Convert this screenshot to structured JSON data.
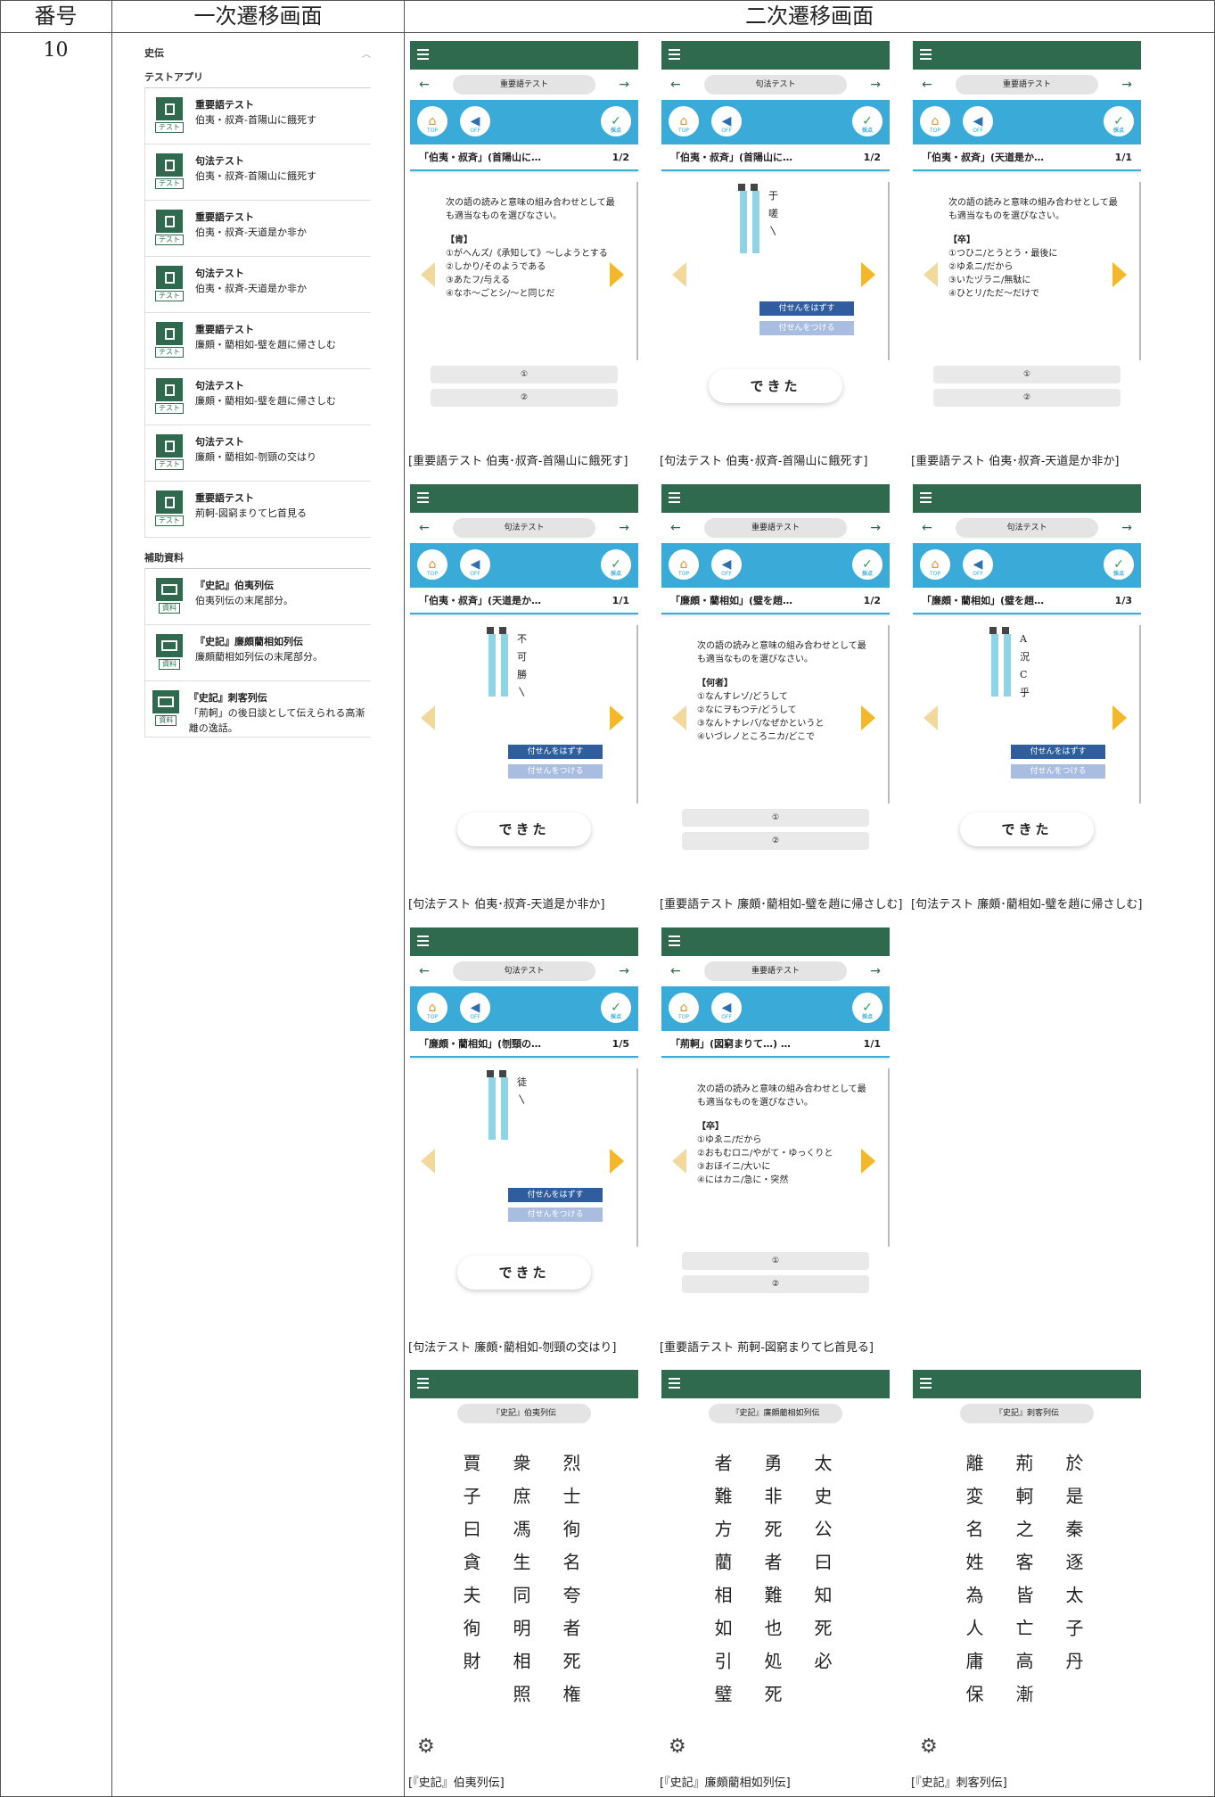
{
  "table": {
    "col_number": "番号",
    "col_primary": "一次遷移画面",
    "col_secondary": "二次遷移画面",
    "row_number": "10"
  },
  "primary": {
    "section": "史伝",
    "test_group": "テストアプリ",
    "material_group": "補助資料",
    "items": [
      {
        "title": "重要語テスト",
        "desc": "伯夷・叔斉-首陽山に餓死す",
        "tag": "テスト"
      },
      {
        "title": "句法テスト",
        "desc": "伯夷・叔斉-首陽山に餓死す",
        "tag": "テスト"
      },
      {
        "title": "重要語テスト",
        "desc": "伯夷・叔斉-天道是か非か",
        "tag": "テスト"
      },
      {
        "title": "句法テスト",
        "desc": "伯夷・叔斉-天道是か非か",
        "tag": "テスト"
      },
      {
        "title": "重要語テスト",
        "desc": "廉頗・藺相如-璧を趙に帰さしむ",
        "tag": "テスト"
      },
      {
        "title": "句法テスト",
        "desc": "廉頗・藺相如-璧を趙に帰さしむ",
        "tag": "テスト"
      },
      {
        "title": "句法テスト",
        "desc": "廉頗・藺相如-刎頸の交はり",
        "tag": "テスト"
      },
      {
        "title": "重要語テスト",
        "desc": "荊軻-図窮まりて匕首見る",
        "tag": "テスト"
      }
    ],
    "materials": [
      {
        "title": "『史記』伯夷列伝",
        "desc": "伯夷列伝の末尾部分。",
        "tag": "資料"
      },
      {
        "title": "『史記』廉頗藺相如列伝",
        "desc": "廉頗藺相如列伝の末尾部分。",
        "tag": "資料"
      },
      {
        "title": "『史記』刺客列伝",
        "desc": "「荊軻」の後日談として伝えられる高漸離の逸話。",
        "tag": "資料"
      }
    ]
  },
  "ui": {
    "top": "TOP",
    "off": "OFF",
    "score": "採点",
    "remove_sticky": "付せんをはずす",
    "add_sticky": "付せんをつける",
    "done": "できた",
    "opt1": "①",
    "opt2": "②",
    "prompt": "次の語の読みと意味の組み合わせとして最も適当なものを選びなさい。"
  },
  "screens": [
    {
      "type": "vocab",
      "pill": "重要語テスト",
      "q": "「伯夷・叔斉」(首陽山に…",
      "page": "1/2",
      "kw": "【肯】",
      "opts": "①がへんズ/《承知して》～しようとする\n②しかり/そのようである\n③あたフ/与える\n④なホ～ごとシ/～と同じだ",
      "caption": "[重要語テスト 伯夷･叔斉-首陽山に餓死す]"
    },
    {
      "type": "grammar",
      "pill": "句法テスト",
      "q": "「伯夷・叔斉」(首陽山に…",
      "page": "1/2",
      "kanbun": "于\n嗟\n〵",
      "caption": "[句法テスト 伯夷･叔斉-首陽山に餓死す]"
    },
    {
      "type": "vocab",
      "pill": "重要語テスト",
      "q": "「伯夷・叔斉」(天道是か…",
      "page": "1/1",
      "kw": "【卒】",
      "opts": "①つひニ/とうとう・最後に\n②ゆゑニ/だから\n③いたヅラニ/無駄に\n④ひとリ/ただ～だけで",
      "caption": "[重要語テスト 伯夷･叔斉-天道是か非か]"
    },
    {
      "type": "grammar",
      "pill": "句法テスト",
      "q": "「伯夷・叔斉」(天道是か…",
      "page": "1/1",
      "kanbun": "不\n可\n勝\n〵",
      "caption": "[句法テスト 伯夷･叔斉-天道是か非か]"
    },
    {
      "type": "vocab",
      "pill": "重要語テスト",
      "q": "「廉頗・藺相如」(璧を趙…",
      "page": "1/2",
      "kw": "【何者】",
      "opts": "①なんすレゾ/どうして\n②なにヲもつテ/どうして\n③なんトナレバ/なぜかというと\n④いづレノところニカ/どこで",
      "caption": "[重要語テスト 廉頗･藺相如-璧を趙に帰さしむ]"
    },
    {
      "type": "grammar",
      "pill": "句法テスト",
      "q": "「廉頗・藺相如」(璧を趙…",
      "page": "1/3",
      "kanbun": "A\n況\nC\n乎",
      "caption": "[句法テスト 廉頗･藺相如-璧を趙に帰さしむ]"
    },
    {
      "type": "grammar",
      "pill": "句法テスト",
      "q": "「廉頗・藺相如」(刎頸の…",
      "page": "1/5",
      "kanbun": "徒\n〵",
      "caption": "[句法テスト 廉頗･藺相如-刎頸の交はり]"
    },
    {
      "type": "vocab",
      "pill": "重要語テスト",
      "q": "「荊軻」(図窮まりて…) …",
      "page": "1/1",
      "kw": "【卒】",
      "opts": "①ゆゑニ/だから\n②おもむロニ/やがて・ゆっくりと\n③おほイニ/大いに\n④にはカニ/急に・突然",
      "caption": "[重要語テスト 荊軻-図窮まりて匕首見る]"
    }
  ],
  "readings": [
    {
      "pill": "『史記』伯夷列伝",
      "cols": [
        "烈士徇名夸者死権",
        "衆庶馮生同明相照",
        "賈子曰貪夫徇財"
      ],
      "caption": "[『史記』伯夷列伝]"
    },
    {
      "pill": "『史記』廉頗藺相如列伝",
      "cols": [
        "太史公曰知死必",
        "勇非死者難也処死",
        "者難方藺相如引璧"
      ],
      "caption": "[『史記』廉頗藺相如列伝]"
    },
    {
      "pill": "『史記』刺客列伝",
      "cols": [
        "於是秦逐太子丹",
        "荊軻之客皆亡高漸",
        "離変名姓為人庸保"
      ],
      "caption": "[『史記』刺客列伝]"
    }
  ]
}
